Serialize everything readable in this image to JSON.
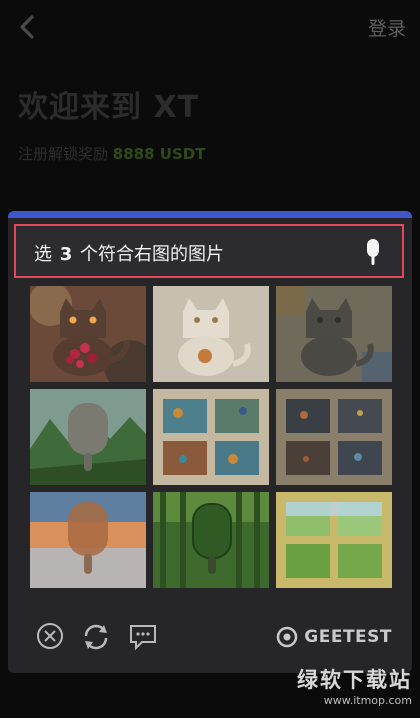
{
  "header": {
    "login_label": "登录"
  },
  "welcome": {
    "title": "欢迎来到 XT",
    "reward_prefix": "注册解锁奖励",
    "reward_amount": "8888 USDT"
  },
  "captcha": {
    "prompt_prefix": "选",
    "prompt_count": "3",
    "prompt_suffix": "个符合右图的图片",
    "hint_icon": "popsicle-icon",
    "accent_color": "#3e56c9",
    "highlight_color": "#e2485a",
    "tiles": [
      {
        "name": "tile-cat-flowers",
        "icon": "cat-icon"
      },
      {
        "name": "tile-cat-white",
        "icon": "cat-icon"
      },
      {
        "name": "tile-cat-mosaic",
        "icon": "cat-icon"
      },
      {
        "name": "tile-popsicle-mountains",
        "icon": "popsicle-icon"
      },
      {
        "name": "tile-window-mosaic",
        "icon": "window-icon"
      },
      {
        "name": "tile-window-dark",
        "icon": "window-icon"
      },
      {
        "name": "tile-popsicle-sunset",
        "icon": "popsicle-icon"
      },
      {
        "name": "tile-popsicle-forest",
        "icon": "popsicle-icon"
      },
      {
        "name": "tile-window-field",
        "icon": "window-icon"
      }
    ],
    "brand": "GEETEST"
  },
  "watermark": {
    "title": "绿软下载站",
    "url": "www.itmop.com"
  }
}
